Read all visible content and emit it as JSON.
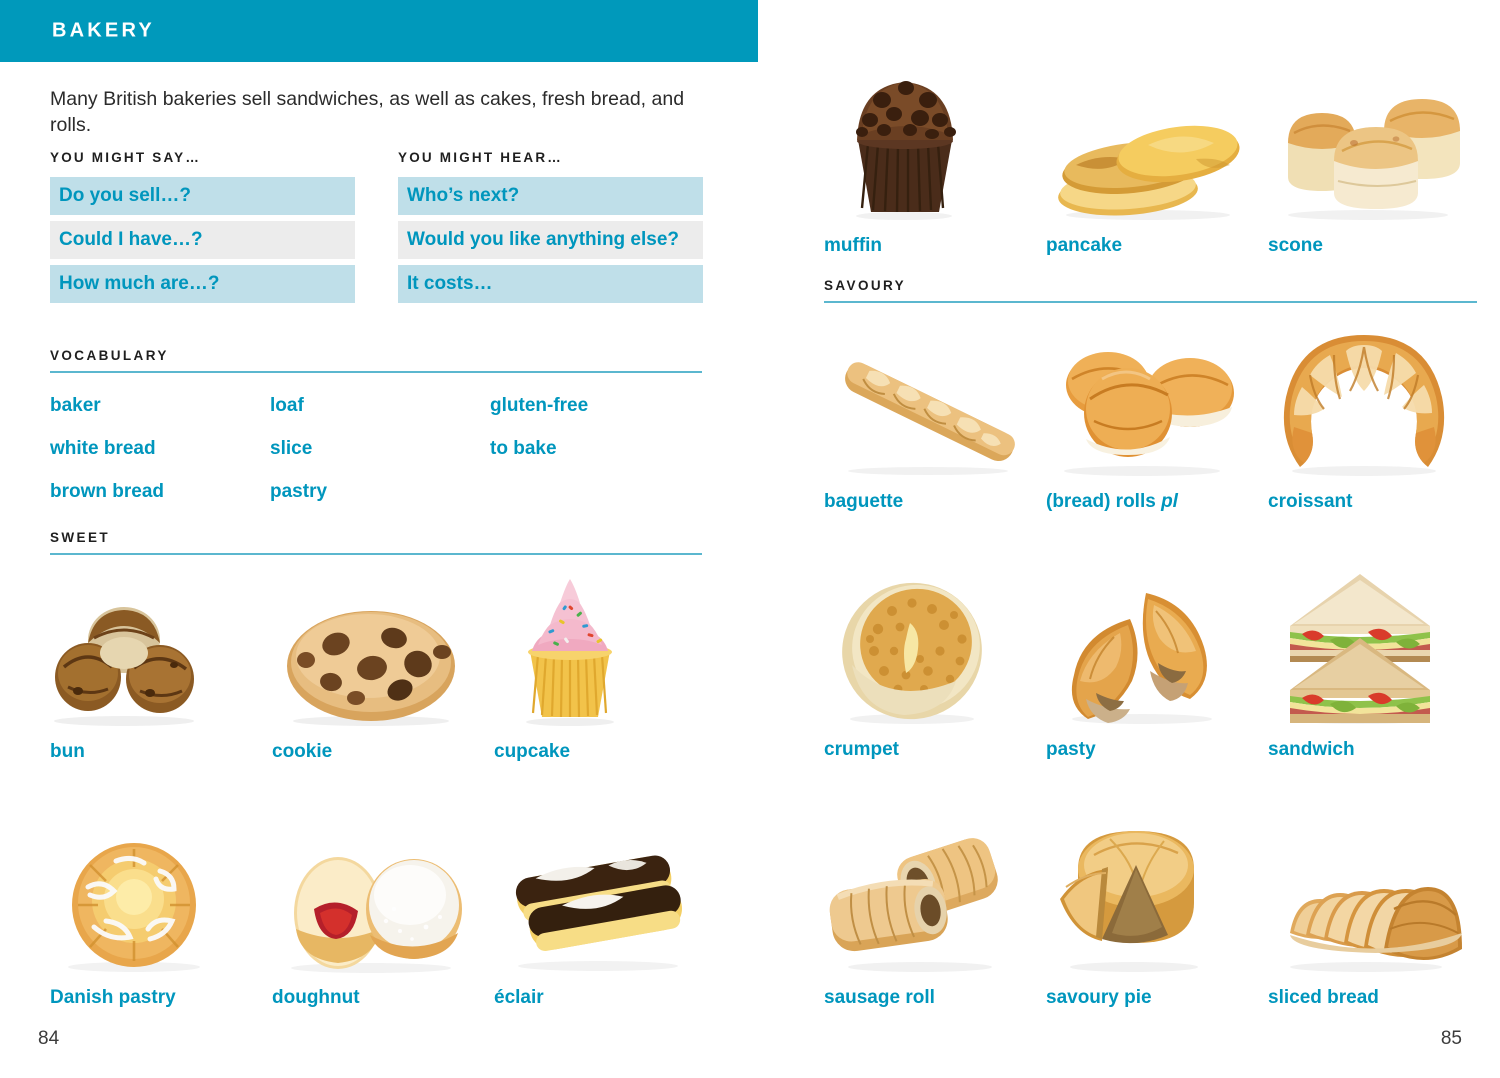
{
  "spread": {
    "banner_title": "BAKERY",
    "intro": "Many British bakeries sell sandwiches, as well as cakes, fresh bread, and rolls.",
    "page_number_left": "84",
    "page_number_right": "85",
    "colors": {
      "banner": "#0099bb",
      "accent_text": "#0096bd",
      "tint_blue": "#bfdfe9",
      "tint_grey": "#ececec",
      "rule": "#5bb7cf"
    }
  },
  "phrases": {
    "say": {
      "heading": "YOU MIGHT SAY…",
      "items": [
        {
          "text": "Do you sell…?",
          "tint": "blue"
        },
        {
          "text": "Could I have…?",
          "tint": "grey"
        },
        {
          "text": "How much are…?",
          "tint": "blue"
        }
      ]
    },
    "hear": {
      "heading": "YOU MIGHT HEAR…",
      "items": [
        {
          "text": "Who’s next?",
          "tint": "blue"
        },
        {
          "text": "Would you like anything else?",
          "tint": "grey"
        },
        {
          "text": "It costs…",
          "tint": "blue"
        }
      ]
    }
  },
  "vocabulary": {
    "heading": "VOCABULARY",
    "rows": [
      [
        "baker",
        "loaf",
        "gluten-free"
      ],
      [
        "white bread",
        "slice",
        "to bake"
      ],
      [
        "brown bread",
        "pastry",
        ""
      ]
    ]
  },
  "sections": {
    "sweet": {
      "heading": "SWEET"
    },
    "savoury": {
      "heading": "SAVOURY"
    }
  },
  "items": {
    "top_right_row": [
      {
        "label": "muffin",
        "icon": "muffin-icon"
      },
      {
        "label": "pancake",
        "icon": "pancake-icon"
      },
      {
        "label": "scone",
        "icon": "scone-icon"
      }
    ],
    "sweet_row_1": [
      {
        "label": "bun",
        "icon": "bun-icon"
      },
      {
        "label": "cookie",
        "icon": "cookie-icon"
      },
      {
        "label": "cupcake",
        "icon": "cupcake-icon"
      }
    ],
    "sweet_row_2": [
      {
        "label": "Danish pastry",
        "icon": "danish-pastry-icon"
      },
      {
        "label": "doughnut",
        "icon": "doughnut-icon"
      },
      {
        "label": "éclair",
        "icon": "eclair-icon"
      }
    ],
    "savoury_row_1": [
      {
        "label": "baguette",
        "icon": "baguette-icon"
      },
      {
        "label": "(bread) rolls ",
        "label_italic": "pl",
        "icon": "bread-rolls-icon"
      },
      {
        "label": "croissant",
        "icon": "croissant-icon"
      }
    ],
    "savoury_row_2": [
      {
        "label": "crumpet",
        "icon": "crumpet-icon"
      },
      {
        "label": "pasty",
        "icon": "pasty-icon"
      },
      {
        "label": "sandwich",
        "icon": "sandwich-icon"
      }
    ],
    "savoury_row_3": [
      {
        "label": "sausage roll",
        "icon": "sausage-roll-icon"
      },
      {
        "label": "savoury pie",
        "icon": "savoury-pie-icon"
      },
      {
        "label": "sliced bread",
        "icon": "sliced-bread-icon"
      }
    ]
  }
}
